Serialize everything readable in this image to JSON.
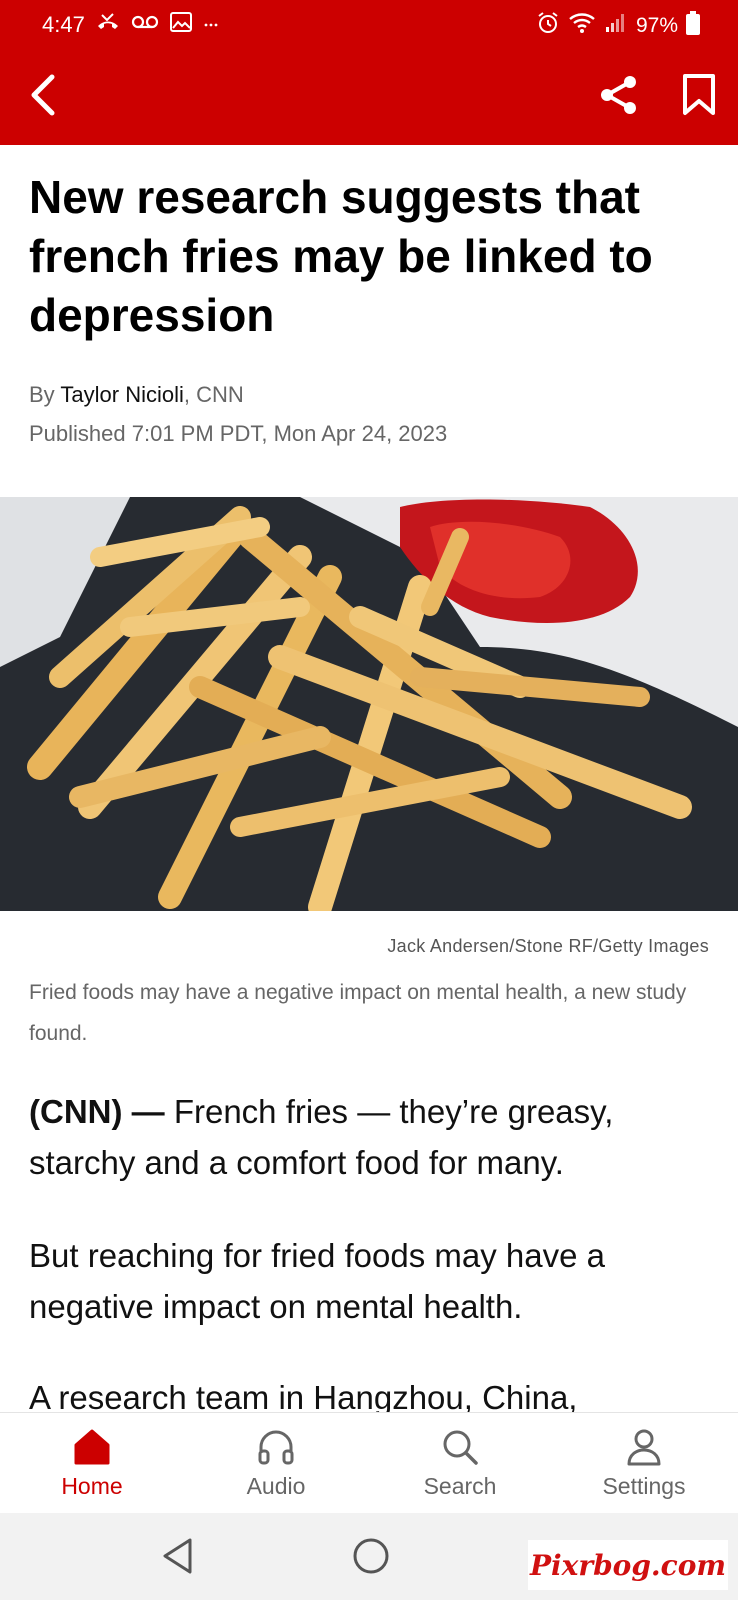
{
  "status_bar": {
    "time": "4:47",
    "battery": "97%"
  },
  "app_bar": {
    "back_icon": "chevron-left-icon",
    "share_icon": "share-icon",
    "bookmark_icon": "bookmark-icon",
    "accent_color": "#cc0000"
  },
  "article": {
    "headline": "New research suggests that french fries may be linked to depression",
    "by_prefix": "By ",
    "author": "Taylor Nicioli",
    "source": ", CNN",
    "published": "Published 7:01 PM PDT, Mon Apr 24, 2023",
    "image_credit": "Jack Andersen/Stone RF/Getty Images",
    "caption": "Fried foods may have a negative impact on mental health, a new study found.",
    "lead": "(CNN) —",
    "p1_rest": " French fries — they’re greasy, starchy and a comfort food for many.",
    "p2": "But reaching for fried foods may have a negative impact on mental health.",
    "p3": "A research team in Hangzhou, China,"
  },
  "bottom_nav": [
    {
      "label": "Home",
      "icon": "home-icon",
      "active": true
    },
    {
      "label": "Audio",
      "icon": "headphones-icon",
      "active": false
    },
    {
      "label": "Search",
      "icon": "search-icon",
      "active": false
    },
    {
      "label": "Settings",
      "icon": "person-icon",
      "active": false
    }
  ],
  "watermark": "Pixrbog.com"
}
